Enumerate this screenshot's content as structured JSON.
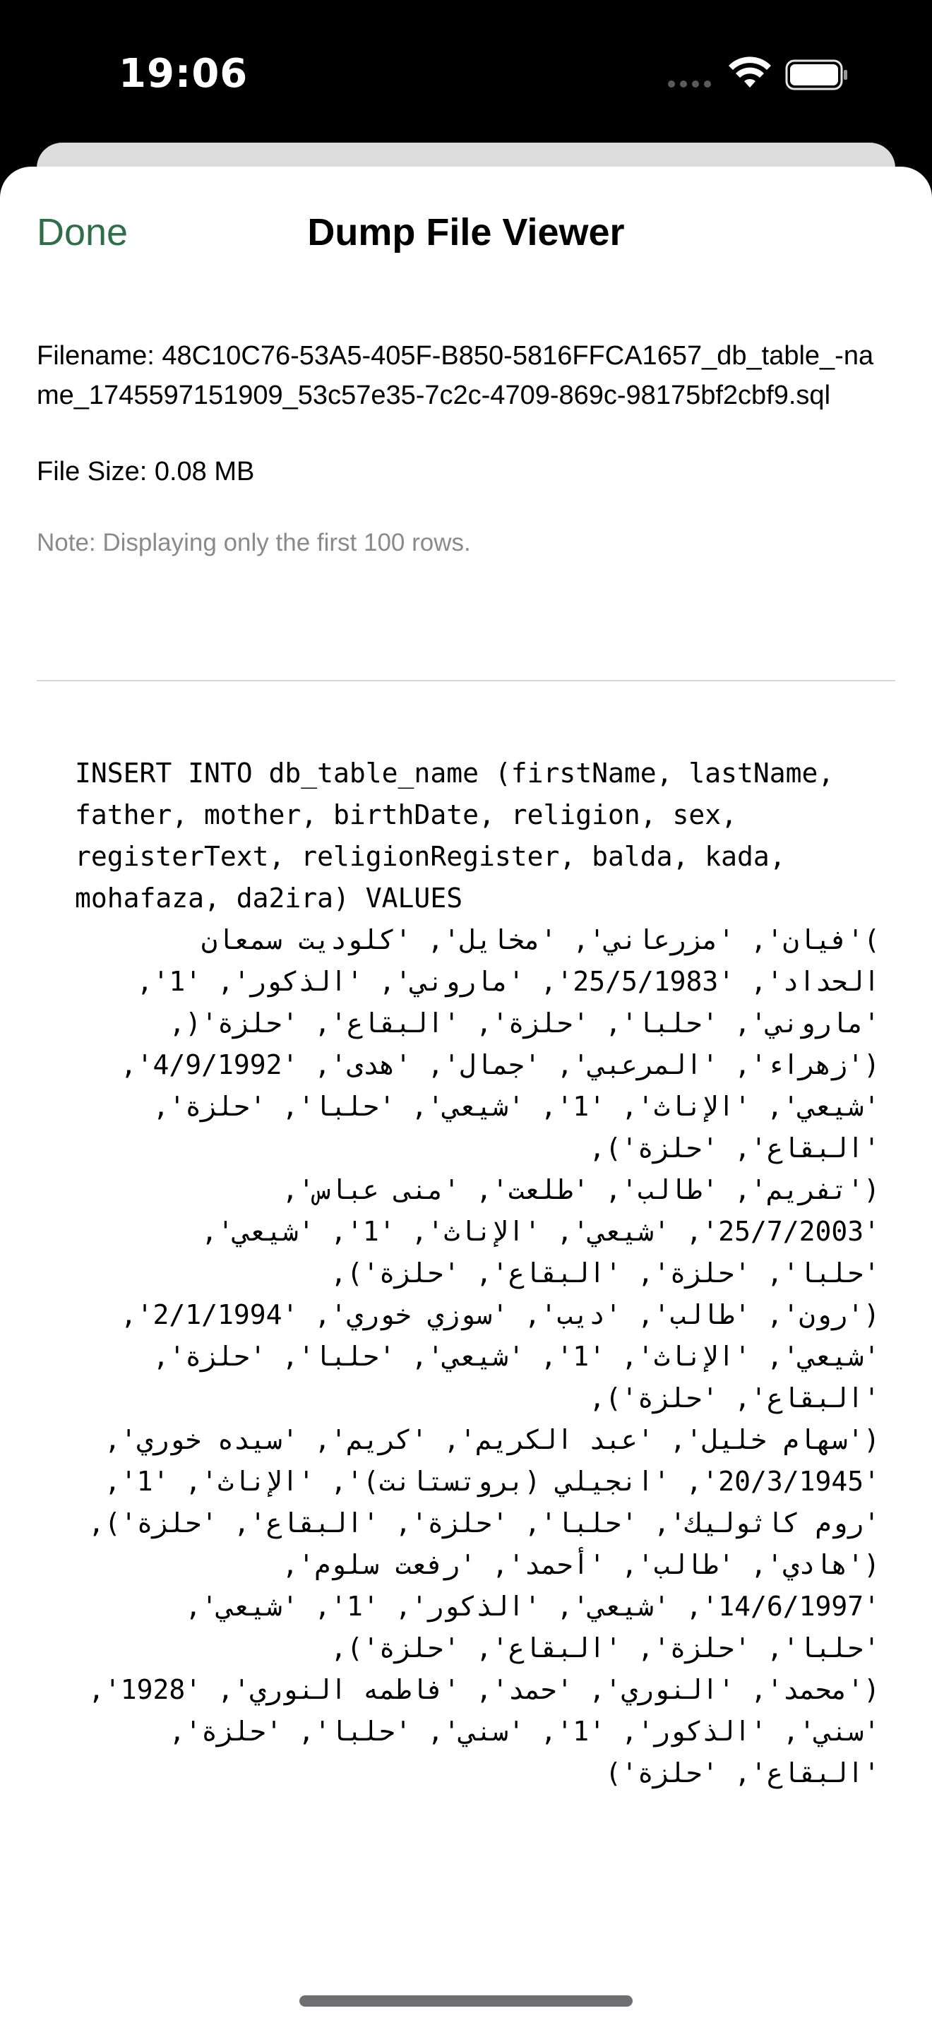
{
  "status_bar": {
    "time": "19:06",
    "icons": [
      "cellular-signal-icon",
      "wifi-icon",
      "battery-icon"
    ]
  },
  "sheet": {
    "done_label": "Done",
    "title": "Dump File Viewer",
    "accent_color": "#2e6f47"
  },
  "file_info": {
    "filename": "Filename: 48C10C76-53A5-405F-B850-5816FFCA1657_db_table_-name_1745597151909_53c57e35-7c2c-4709-869c-98175bf2cbf9.sql",
    "file_size": "File Size: 0.08 MB",
    "note": "Note: Displaying only the first 100 rows."
  },
  "dump": {
    "content": "INSERT INTO db_table_name (firstName, lastName, father, mother, birthDate, religion, sex, registerText, religionRegister, balda, kada, mohafaza, da2ira) VALUES\n('فيان', 'مزرعاني', 'مخايل', 'كلوديت سمعان الحداد', '25/5/1983', 'ماروني', 'الذكور', '1', 'ماروني', 'حلبا', 'حلزة', 'البقاع', 'حلزة'),\n('زهراء', 'المرعبي', 'جمال', 'هدى', '4/9/1992', 'شيعي', 'الإناث', '1', 'شيعي', 'حلبا', 'حلزة', 'البقاع', 'حلزة'),\n('تفريم', 'طالب', 'طلعت', 'منى عباس', '25/7/2003', 'شيعي', 'الإناث', '1', 'شيعي', 'حلبا', 'حلزة', 'البقاع', 'حلزة'),\n('رون', 'طالب', 'ديب', 'سوزي خوري', '2/1/1994', 'شيعي', 'الإناث', '1', 'شيعي', 'حلبا', 'حلزة', 'البقاع', 'حلزة'),\n('سهام خليل', 'عبد الكريم', 'كريم', 'سيده خوري', '20/3/1945', 'انجيلي (بروتستانت)', 'الإناث', '1', 'روم كاثوليك', 'حلبا', 'حلزة', 'البقاع', 'حلزة'),\n('هادي', 'طالب', 'أحمد', 'رفعت سلوم', '14/6/1997', 'شيعي', 'الذكور', '1', 'شيعي', 'حلبا', 'حلزة', 'البقاع', 'حلزة'),\n('محمد', 'النوري', 'حمد', 'فاطمه النوري', '1928', 'سني', 'الذكور', '1', 'سني', 'حلبا', 'حلزة', 'البقاع', 'حلزة')"
  }
}
